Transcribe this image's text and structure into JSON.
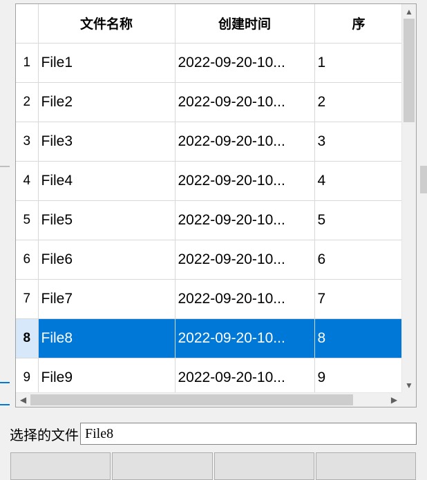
{
  "table": {
    "headers": {
      "filename": "文件名称",
      "created": "创建时间",
      "seq": "序"
    },
    "rows": [
      {
        "num": "1",
        "filename": "File1",
        "created": "2022-09-20-10...",
        "seq": "1",
        "selected": false
      },
      {
        "num": "2",
        "filename": "File2",
        "created": "2022-09-20-10...",
        "seq": "2",
        "selected": false
      },
      {
        "num": "3",
        "filename": "File3",
        "created": "2022-09-20-10...",
        "seq": "3",
        "selected": false
      },
      {
        "num": "4",
        "filename": "File4",
        "created": "2022-09-20-10...",
        "seq": "4",
        "selected": false
      },
      {
        "num": "5",
        "filename": "File5",
        "created": "2022-09-20-10...",
        "seq": "5",
        "selected": false
      },
      {
        "num": "6",
        "filename": "File6",
        "created": "2022-09-20-10...",
        "seq": "6",
        "selected": false
      },
      {
        "num": "7",
        "filename": "File7",
        "created": "2022-09-20-10...",
        "seq": "7",
        "selected": false
      },
      {
        "num": "8",
        "filename": "File8",
        "created": "2022-09-20-10...",
        "seq": "8",
        "selected": true
      },
      {
        "num": "9",
        "filename": "File9",
        "created": "2022-09-20-10...",
        "seq": "9",
        "selected": false
      }
    ]
  },
  "selected": {
    "label": "选择的文件",
    "value": "File8"
  }
}
